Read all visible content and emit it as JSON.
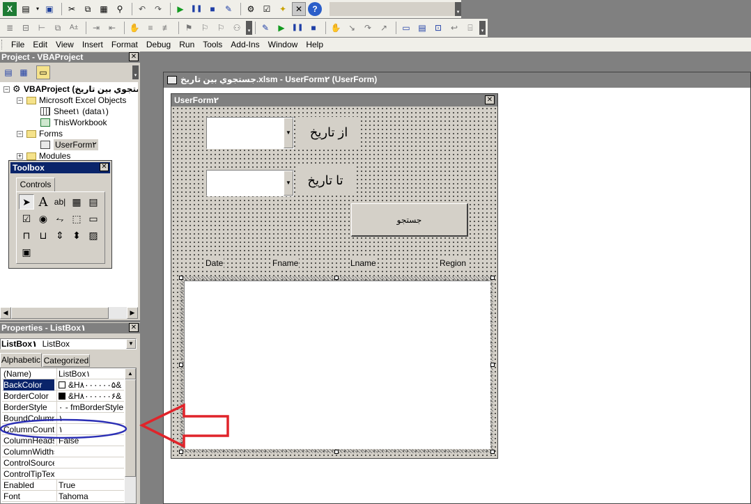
{
  "menu": {
    "items": [
      "File",
      "Edit",
      "View",
      "Insert",
      "Format",
      "Debug",
      "Run",
      "Tools",
      "Add-Ins",
      "Window",
      "Help"
    ]
  },
  "project": {
    "title": "Project - VBAProject",
    "root": "VBAProject (جستجوي بين تاريخ",
    "excel_objects": "Microsoft Excel Objects",
    "sheet": "Sheet۱ (data۱)",
    "workbook": "ThisWorkbook",
    "forms": "Forms",
    "userform": "UserForm۲",
    "modules": "Modules"
  },
  "toolbox": {
    "title": "Toolbox",
    "tab": "Controls"
  },
  "properties": {
    "title": "Properties - ListBox۱",
    "object": "ListBox۱",
    "object_type": "ListBox",
    "tabs": [
      "Alphabetic",
      "Categorized"
    ],
    "rows": [
      {
        "name": "(Name)",
        "value": "ListBox۱"
      },
      {
        "name": "BackColor",
        "value": "&H۸۰۰۰۰۰۰۵&"
      },
      {
        "name": "BorderColor",
        "value": "&H۸۰۰۰۰۰۰۶&"
      },
      {
        "name": "BorderStyle",
        "value": "۰ - fmBorderStyleNone"
      },
      {
        "name": "BoundColumn",
        "value": "۱"
      },
      {
        "name": "ColumnCount",
        "value": "۱"
      },
      {
        "name": "ColumnHeads",
        "value": "False"
      },
      {
        "name": "ColumnWidths",
        "value": ""
      },
      {
        "name": "ControlSource",
        "value": ""
      },
      {
        "name": "ControlTipText",
        "value": ""
      },
      {
        "name": "Enabled",
        "value": "True"
      },
      {
        "name": "Font",
        "value": "Tahoma"
      }
    ]
  },
  "designer": {
    "window_title": "جستجوي بين تاريخ.xlsm - UserForm۲ (UserForm)",
    "form_title": "UserForm۲",
    "from_label": "از تاريخ",
    "to_label": "تا تاريخ",
    "search_button": "جستجو",
    "columns": [
      "Date",
      "Fname",
      "Lname",
      "Region"
    ]
  },
  "colors": {
    "annotation_arrow": "#e0242a",
    "annotation_ellipse": "#2b2fb5",
    "selection": "#0a246a"
  }
}
